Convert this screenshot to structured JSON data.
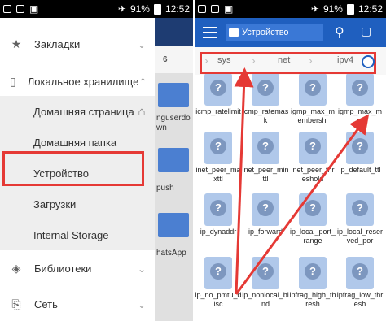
{
  "status_left": {
    "time": "12:52",
    "battery": "91%"
  },
  "status_right": {
    "time": "12:52",
    "battery": "91%"
  },
  "drawer": {
    "items": [
      {
        "label": "Закладки",
        "icon": "star-icon"
      },
      {
        "label": "Локальное хранилище",
        "icon": "phone-icon"
      },
      {
        "label": "Домашняя страница",
        "icon": "home-icon"
      },
      {
        "label": "Домашняя папка",
        "icon": ""
      },
      {
        "label": "Устройство",
        "icon": ""
      },
      {
        "label": "Загрузки",
        "icon": ""
      },
      {
        "label": "Internal Storage",
        "icon": ""
      },
      {
        "label": "Библиотеки",
        "icon": "layers-icon"
      },
      {
        "label": "Сеть",
        "icon": "network-icon"
      }
    ]
  },
  "peek": {
    "number": "6",
    "text1": "nguserdo",
    "text2": "wn",
    "text3": "push",
    "text4": "hatsApp"
  },
  "app_bar": {
    "title": "Устройство"
  },
  "breadcrumb": {
    "parts": [
      "sys",
      "net",
      "ipv4"
    ]
  },
  "files": [
    "icmp_ratelimit",
    "icmp_ratemask",
    "igmp_max_membershi",
    "igmp_max_msf",
    "inet_peer_maxttl",
    "inet_peer_minttl",
    "inet_peer_threshold",
    "ip_default_ttl",
    "ip_dynaddr",
    "ip_forward",
    "ip_local_port_range",
    "ip_local_reserved_por",
    "ip_no_pmtu_disc",
    "ip_nonlocal_bind",
    "ipfrag_high_thresh",
    "ipfrag_low_thresh"
  ]
}
